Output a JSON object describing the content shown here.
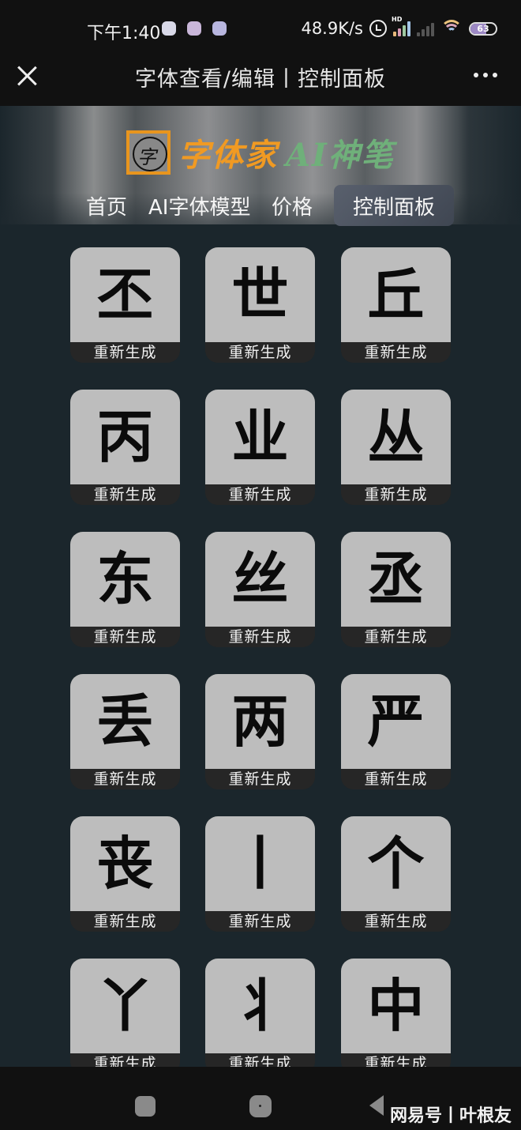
{
  "status_bar": {
    "time": "下午1:40",
    "app_icons": [
      "app-notification-icon-1",
      "app-notification-icon-2",
      "app-notification-icon-3"
    ],
    "net_speed": "48.9K/s",
    "signal_label": "HD",
    "battery_level": "63",
    "battery_percent": 63
  },
  "title_bar": {
    "title": "字体查看/编辑丨控制面板",
    "close_icon": "close-icon",
    "more_icon": "more-icon"
  },
  "header": {
    "logo_glyph": "字",
    "logo_text_cn": "字体家",
    "logo_text_ai": "AI神笔",
    "nav": [
      {
        "label": "首页",
        "active": false
      },
      {
        "label": "AI字体模型",
        "active": false
      },
      {
        "label": "价格",
        "active": false
      },
      {
        "label": "控制面板",
        "active": true
      }
    ]
  },
  "grid": {
    "button_label": "重新生成",
    "chars": [
      "丕",
      "世",
      "丘",
      "丙",
      "业",
      "丛",
      "东",
      "丝",
      "丞",
      "丢",
      "两",
      "严",
      "丧",
      "丨",
      "个",
      "丫",
      "丬",
      "中"
    ]
  },
  "nav_bar": {
    "watermark": "网易号丨叶根友"
  },
  "colors": {
    "accent_orange": "#f09a23",
    "accent_green": "#6fb07a",
    "content_bg": "#1b262c",
    "card_bg": "#bdbdbd"
  }
}
